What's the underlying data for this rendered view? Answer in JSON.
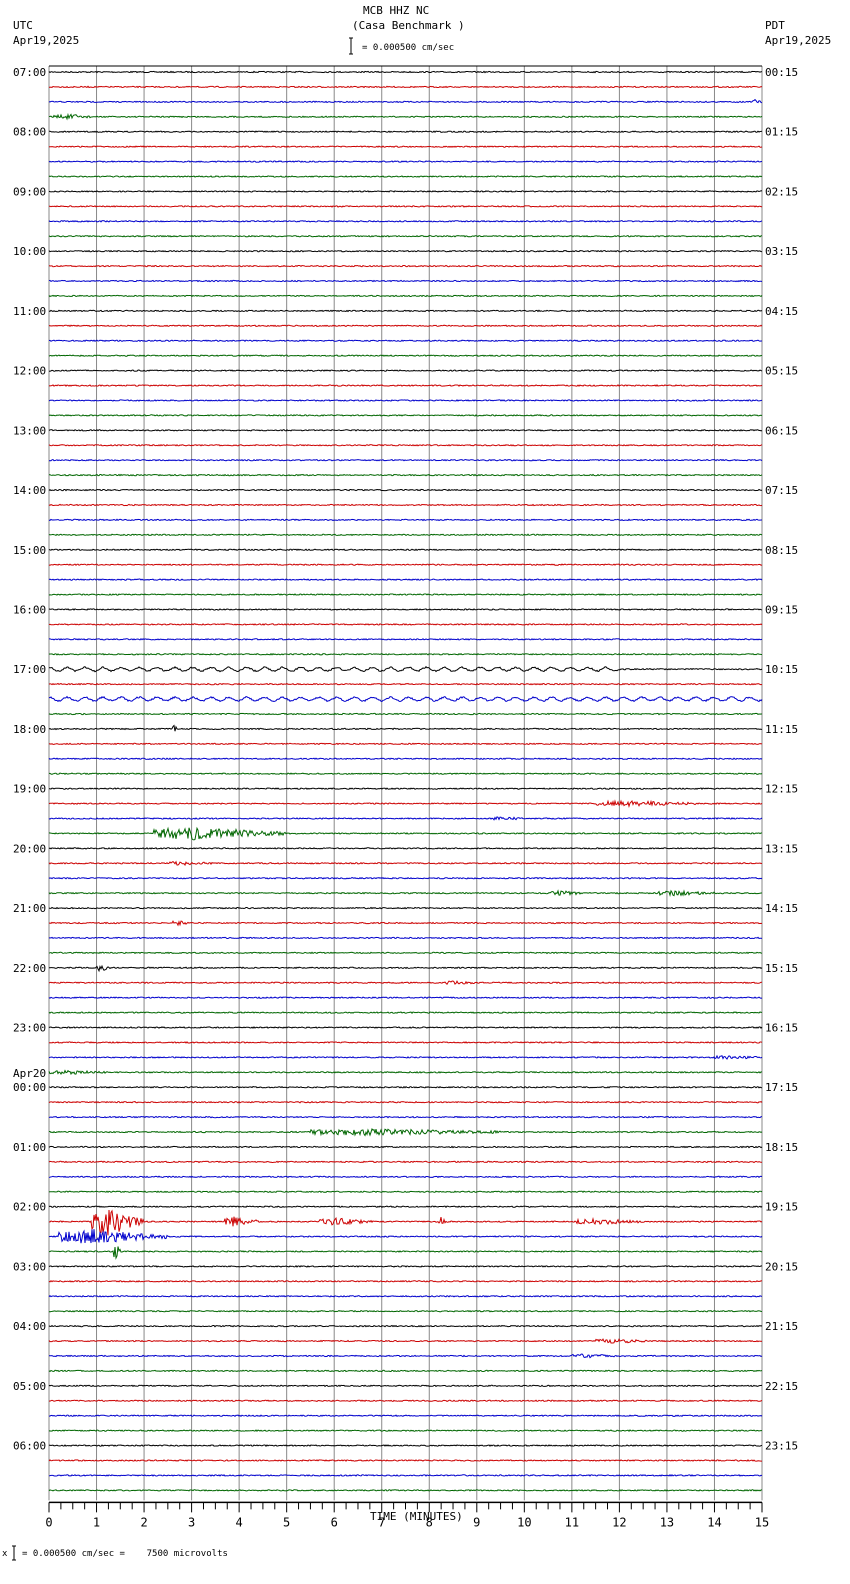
{
  "header": {
    "title": "MCB HHZ NC",
    "subtitle": "(Casa Benchmark )",
    "left_tz": "UTC",
    "left_date": "Apr19,2025",
    "right_tz": "PDT",
    "right_date": "Apr19,2025",
    "scale_text": "= 0.000500 cm/sec"
  },
  "footer": {
    "scale_text": "= 0.000500 cm/sec =    7500 microvolts",
    "prefix": "x"
  },
  "chart_data": {
    "type": "line",
    "title": "MCB HHZ NC (Casa Benchmark )",
    "xlabel": "TIME (MINUTES)",
    "xlim": [
      0,
      15
    ],
    "x_ticks": [
      "0",
      "1",
      "2",
      "3",
      "4",
      "5",
      "6",
      "7",
      "8",
      "9",
      "10",
      "11",
      "12",
      "13",
      "14",
      "15"
    ],
    "traces_per_hour": 4,
    "trace_count": 96,
    "trace_colors": [
      "#000000",
      "#cc0000",
      "#0000cc",
      "#006600"
    ],
    "left_labels": [
      "07:00",
      "08:00",
      "09:00",
      "10:00",
      "11:00",
      "12:00",
      "13:00",
      "14:00",
      "15:00",
      "16:00",
      "17:00",
      "18:00",
      "19:00",
      "20:00",
      "21:00",
      "22:00",
      "23:00",
      "00:00",
      "01:00",
      "02:00",
      "03:00",
      "04:00",
      "05:00",
      "06:00"
    ],
    "left_date_change": {
      "hour_index": 17,
      "label": "Apr20"
    },
    "right_labels": [
      "00:15",
      "01:15",
      "02:15",
      "03:15",
      "04:15",
      "05:15",
      "06:15",
      "07:15",
      "08:15",
      "09:15",
      "10:15",
      "11:15",
      "12:15",
      "13:15",
      "14:15",
      "15:15",
      "16:15",
      "17:15",
      "18:15",
      "19:15",
      "20:15",
      "21:15",
      "22:15",
      "23:15"
    ],
    "events": [
      {
        "trace": 2,
        "start": 14.8,
        "end": 15,
        "amp": 4
      },
      {
        "trace": 3,
        "start": 0.1,
        "end": 0.9,
        "amp": 5
      },
      {
        "trace": 40,
        "start": 0,
        "end": 12,
        "amp": 3,
        "wave": true
      },
      {
        "trace": 42,
        "start": 0,
        "end": 15,
        "amp": 3,
        "wave": true
      },
      {
        "trace": 44,
        "start": 2.6,
        "end": 2.75,
        "amp": 8
      },
      {
        "trace": 49,
        "start": 11.5,
        "end": 13.6,
        "amp": 5
      },
      {
        "trace": 50,
        "start": 9.3,
        "end": 10,
        "amp": 3
      },
      {
        "trace": 51,
        "start": 2.2,
        "end": 5,
        "amp": 12
      },
      {
        "trace": 53,
        "start": 2.5,
        "end": 3.5,
        "amp": 3
      },
      {
        "trace": 55,
        "start": 10.5,
        "end": 11.3,
        "amp": 4
      },
      {
        "trace": 55,
        "start": 12.8,
        "end": 14,
        "amp": 4
      },
      {
        "trace": 57,
        "start": 2.6,
        "end": 2.9,
        "amp": 5
      },
      {
        "trace": 60,
        "start": 1.0,
        "end": 1.3,
        "amp": 6
      },
      {
        "trace": 61,
        "start": 8.3,
        "end": 9,
        "amp": 3
      },
      {
        "trace": 66,
        "start": 14,
        "end": 15,
        "amp": 3
      },
      {
        "trace": 67,
        "start": 0,
        "end": 1.2,
        "amp": 3
      },
      {
        "trace": 71,
        "start": 5.5,
        "end": 9.5,
        "amp": 6
      },
      {
        "trace": 77,
        "start": 0.9,
        "end": 2,
        "amp": 28
      },
      {
        "trace": 77,
        "start": 3.7,
        "end": 4.4,
        "amp": 10
      },
      {
        "trace": 77,
        "start": 5.7,
        "end": 6.8,
        "amp": 6
      },
      {
        "trace": 77,
        "start": 8.2,
        "end": 8.35,
        "amp": 10
      },
      {
        "trace": 77,
        "start": 11.1,
        "end": 12.5,
        "amp": 5
      },
      {
        "trace": 78,
        "start": 0.2,
        "end": 2.5,
        "amp": 14
      },
      {
        "trace": 79,
        "start": 1.35,
        "end": 1.5,
        "amp": 30
      },
      {
        "trace": 85,
        "start": 11.5,
        "end": 12.6,
        "amp": 4
      },
      {
        "trace": 86,
        "start": 11.0,
        "end": 11.9,
        "amp": 3
      }
    ]
  }
}
